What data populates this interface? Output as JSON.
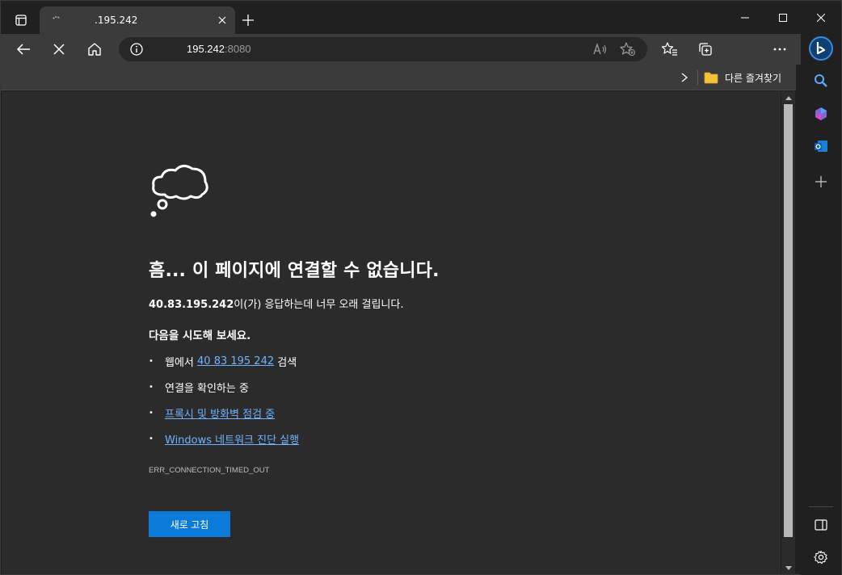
{
  "tab": {
    "title": ".195.242"
  },
  "address_bar": {
    "host": "195.242",
    "port": ":8080"
  },
  "favorites_bar": {
    "other_favorites_label": "다른 즐겨찾기"
  },
  "error_page": {
    "heading": "흠... 이 페이지에 연결할 수 없습니다.",
    "detail_host": "40.83.195.242",
    "detail_text": "이(가) 응답하는데 너무 오래 걸립니다.",
    "try_label": "다음을 시도해 보세요.",
    "suggestions": [
      {
        "prefix": "웹에서 ",
        "link": "40 83 195 242",
        "suffix": " 검색"
      },
      {
        "prefix": "연결을 확인하는 중",
        "link": "",
        "suffix": ""
      },
      {
        "prefix": "",
        "link": "프록시 및 방화벽 점검 중",
        "suffix": ""
      },
      {
        "prefix": "",
        "link": "Windows 네트워크 진단 실행",
        "suffix": ""
      }
    ],
    "error_code": "ERR_CONNECTION_TIMED_OUT",
    "reload_label": "새로 고침"
  },
  "colors": {
    "accent": "#0c7ad9",
    "link": "#6fb2ff",
    "page_bg": "#2b2b2b",
    "chrome_bg": "#3b3b3b",
    "frame_bg": "#202020"
  }
}
